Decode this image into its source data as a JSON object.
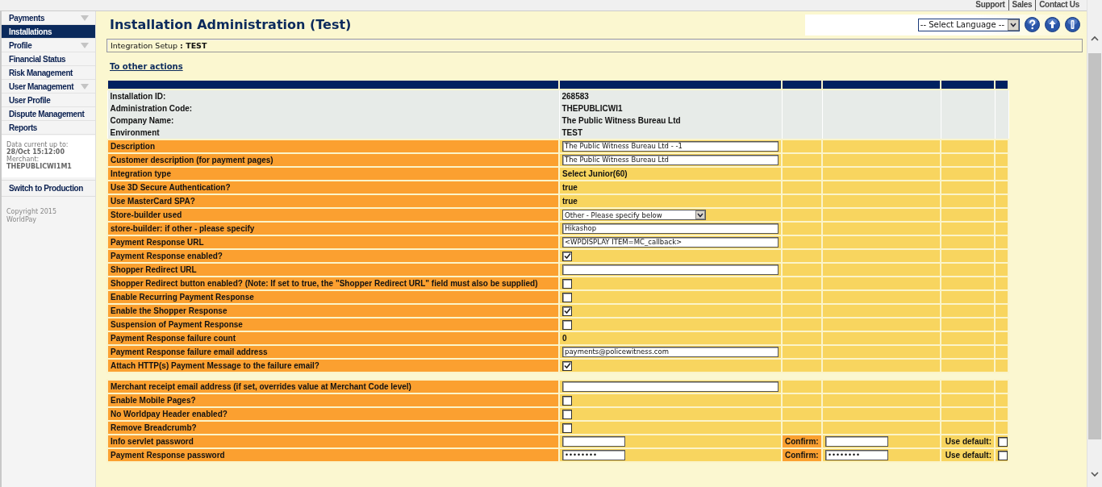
{
  "top_links": [
    {
      "label": "Support"
    },
    {
      "label": "Sales"
    },
    {
      "label": "Contact Us"
    }
  ],
  "sidebar": {
    "items": [
      {
        "label": "Payments",
        "expandable": true,
        "selected": false
      },
      {
        "label": "Installations",
        "expandable": false,
        "selected": true
      },
      {
        "label": "Profile",
        "expandable": true,
        "selected": false
      },
      {
        "label": "Financial Status",
        "expandable": false,
        "selected": false
      },
      {
        "label": "Risk Management",
        "expandable": false,
        "selected": false
      },
      {
        "label": "User Management",
        "expandable": true,
        "selected": false
      },
      {
        "label": "User Profile",
        "expandable": false,
        "selected": false
      },
      {
        "label": "Dispute Management",
        "expandable": false,
        "selected": false
      },
      {
        "label": "Reports",
        "expandable": false,
        "selected": false
      }
    ],
    "status": [
      {
        "label": "Data current up to:",
        "value": "28/Oct 15:12:00"
      },
      {
        "label": "Merchant:",
        "value": "THEPUBLICWI1M1"
      }
    ],
    "action": "Switch to Production",
    "copyright": "Copyright 2015 WorldPay"
  },
  "header": {
    "title": "Installation Administration (Test)",
    "language_select": "-- Select Language --"
  },
  "breadcrumb": "Integration Setup **: TEST**",
  "other_actions_link": "To other actions",
  "table": {
    "sections": [
      {
        "kind": "info",
        "rows": [
          {
            "kind": "text",
            "label": "Installation ID:",
            "value": "268583"
          },
          {
            "kind": "text",
            "label": "Administration Code:",
            "value": "THEPUBLICWI1"
          },
          {
            "kind": "text",
            "label": "Company Name:",
            "value": "The Public Witness Bureau Ltd"
          },
          {
            "kind": "text",
            "label": "Environment",
            "value": "TEST"
          }
        ]
      },
      {
        "kind": "settings",
        "rows": [
          {
            "kind": "input",
            "label": "Description",
            "value": "The Public Witness Bureau Ltd - -1"
          },
          {
            "kind": "input",
            "label": "Customer description (for payment pages)",
            "value": "The Public Witness Bureau Ltd"
          },
          {
            "kind": "text",
            "label": "Integration type",
            "value": "Select Junior(60)"
          },
          {
            "kind": "text",
            "label": "Use 3D Secure Authentication?",
            "value": "true"
          },
          {
            "kind": "text",
            "label": "Use MasterCard SPA?",
            "value": "true"
          },
          {
            "kind": "select",
            "label": "Store-builder used",
            "value": "Other - Please specify below"
          },
          {
            "kind": "input",
            "label": "store-builder: if other - please specify",
            "value": "Hikashop"
          },
          {
            "kind": "input",
            "label": "Payment Response URL",
            "value": "<WPDISPLAY ITEM=MC_callback>"
          },
          {
            "kind": "checkbox",
            "label": "Payment Response enabled?",
            "checked": true
          },
          {
            "kind": "input",
            "label": "Shopper Redirect URL"
          },
          {
            "kind": "checkbox",
            "label": "Shopper Redirect button enabled? (Note: If set to true, the \"Shopper Redirect URL\" field must also be supplied)",
            "checked": false
          },
          {
            "kind": "checkbox",
            "label": "Enable Recurring Payment Response",
            "checked": false
          },
          {
            "kind": "checkbox",
            "label": "Enable the Shopper Response",
            "checked": true
          },
          {
            "kind": "checkbox",
            "label": "Suspension of Payment Response",
            "checked": false
          },
          {
            "kind": "text",
            "label": "Payment Response failure count",
            "value": "0"
          },
          {
            "kind": "input",
            "label": "Payment Response failure email address",
            "value": "payments@policewitness.com"
          },
          {
            "kind": "checkbox",
            "label": "Attach HTTP(s) Payment Message to the failure email?",
            "checked": true
          }
        ]
      },
      {
        "kind": "settings",
        "rows": [
          {
            "kind": "input",
            "label": "Merchant receipt email address (if set, overrides value at Merchant Code level)"
          },
          {
            "kind": "checkbox",
            "label": "Enable Mobile Pages?",
            "checked": false
          },
          {
            "kind": "checkbox",
            "label": "No Worldpay Header enabled?",
            "checked": false
          },
          {
            "kind": "checkbox",
            "label": "Remove Breadcrumb?",
            "checked": false
          },
          {
            "kind": "password",
            "label": "Info servlet password",
            "confirm_label": "Confirm:",
            "default_label": "Use default:",
            "use_default": false
          },
          {
            "kind": "password",
            "label": "Payment Response password",
            "value": "••••••••",
            "confirm_label": "Confirm:",
            "confirm_value": "••••••••",
            "default_label": "Use default:",
            "use_default": false
          }
        ]
      }
    ]
  }
}
